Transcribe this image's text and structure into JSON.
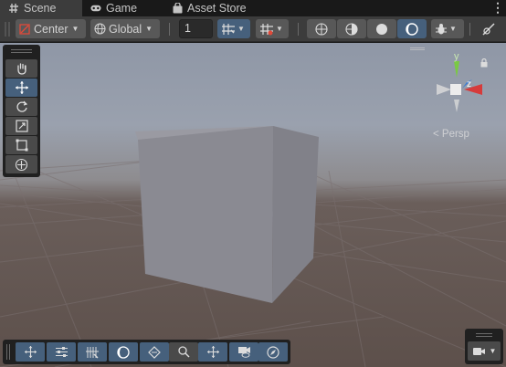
{
  "tabs": [
    {
      "label": "Scene",
      "icon": "hash-icon",
      "active": true
    },
    {
      "label": "Game",
      "icon": "gamepad-icon",
      "active": false
    },
    {
      "label": "Asset Store",
      "icon": "shopping-bag-icon",
      "active": false
    }
  ],
  "toolbar": {
    "pivot_label": "Center",
    "space_label": "Global",
    "increment_value": "1"
  },
  "gizmo": {
    "y_label": "y",
    "z_label": "z",
    "persp_label": "< Persp"
  },
  "colors": {
    "selected_blue": "#46607c",
    "axis_x": "#d63b3b",
    "axis_y": "#7ac943",
    "axis_z": "#3a7bd5",
    "cube_face": "#8a8a92"
  }
}
